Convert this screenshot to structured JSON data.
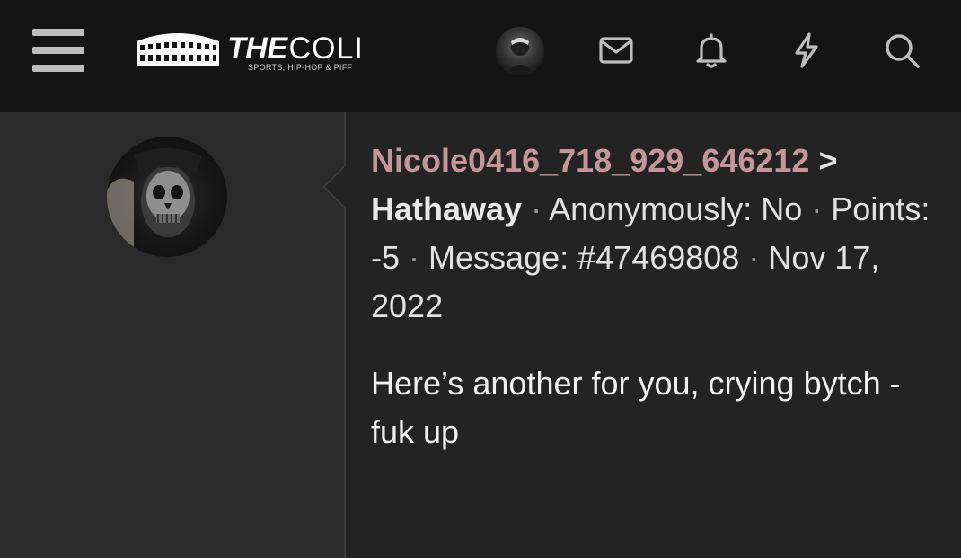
{
  "header": {
    "brand_bold": "THE",
    "brand_regular": "COLI",
    "tagline": "SPORTS, HIP-HOP & PIFF",
    "icons": [
      "menu-icon",
      "mail-icon",
      "bell-icon",
      "lightning-icon",
      "search-icon"
    ]
  },
  "post": {
    "author": "Nicole0416_718_929_646212",
    "arrow": ">",
    "recipient": "Hathaway",
    "anonymously": "Anonymously: No",
    "points": "Points: -5",
    "message_id": "Message: #47469808",
    "date": "Nov 17, 2022",
    "separator": "·",
    "body": "Here’s another for you, crying bytch - fuk up"
  },
  "colors": {
    "topbar": "#141414",
    "background": "#232323",
    "sidebar": "#2a2a2a",
    "author": "#c4959b"
  }
}
